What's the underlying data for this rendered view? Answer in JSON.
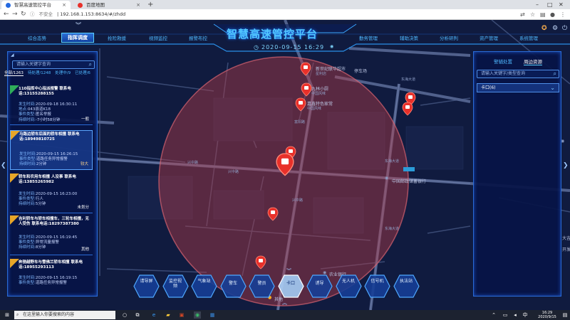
{
  "browser": {
    "tabs": [
      {
        "title": "智慧高速管控平台",
        "active": true
      },
      {
        "title": "百度地图",
        "active": false
      }
    ],
    "security_label": "不安全",
    "url": "192.168.1.153:8634/#/zhdd"
  },
  "header": {
    "nav_left": [
      "综合态势",
      "指挥调度",
      "抢险救援",
      "视频监控",
      "报警布控"
    ],
    "nav_right": [
      "勤务管理",
      "辅助决策",
      "分析研判",
      "资产管理",
      "系统管理"
    ],
    "active_nav": "指挥调度",
    "title": "智慧高速管控平台",
    "datetime": "2020-09-15 16:29"
  },
  "left_panel": {
    "search_placeholder": "请输入关键字查询",
    "filters": {
      "all": "全部/1263",
      "pending": "待处理/1248",
      "processing": "处理中/9",
      "done": "已处理/6"
    },
    "incidents": [
      {
        "ribbon": "已派",
        "title": "110指挥中心指派报警",
        "phone_label": "联系电话:",
        "phone": "13155288155",
        "rows": [
          {
            "label": "发生时间:",
            "value": "2020-09-18 16:30:11"
          },
          {
            "label": "地点:",
            "value": "043县道K18"
          },
          {
            "label": "事件类型:",
            "value": "匿名举报"
          },
          {
            "label": "持续时间:",
            "value": "-7小时58分钟"
          }
        ],
        "status": "一般"
      },
      {
        "ribbon": "急",
        "title": "马路边轿车后面的轿车相撞",
        "phone_label": "联系电话:",
        "phone": "18949810725",
        "rows": [
          {
            "label": "发生时间:",
            "value": "2020-09-15 16:26:15"
          },
          {
            "label": "事件类型:",
            "value": "道路任务异常报警"
          },
          {
            "label": "持续时间:",
            "value": "2分钟"
          }
        ],
        "status": "较大",
        "selected": true
      },
      {
        "ribbon": "急",
        "title": "轿车和农用车相撞 人没事",
        "phone_label": "联系电话:",
        "phone": "13855265982",
        "rows": [
          {
            "label": "发生时间:",
            "value": "2020-09-15 16:23:00"
          },
          {
            "label": "事件类型:",
            "value": "行人"
          },
          {
            "label": "持续时间:",
            "value": "5分钟"
          }
        ],
        "status": "未划分"
      },
      {
        "ribbon": "急",
        "title": "吉利轿车与轿车相撞车，三轮车相撞，无人受伤",
        "phone_label": "联系电话:",
        "phone": "18297387380",
        "rows": [
          {
            "label": "发生时间:",
            "value": "2020-09-15 16:19:45"
          },
          {
            "label": "事件类型:",
            "value": "异常流量报警"
          },
          {
            "label": "持续时间:",
            "value": "8分钟"
          }
        ],
        "status": "其他"
      },
      {
        "ribbon": "急",
        "title": "奔驰越野车与雪佛兰轿车相撞",
        "phone_label": "联系电话:",
        "phone": "18955293113",
        "rows": [
          {
            "label": "发生时间:",
            "value": "2020-09-15 16:19:15"
          },
          {
            "label": "事件类型:",
            "value": "道路任务异常报警"
          }
        ],
        "status": ""
      }
    ]
  },
  "right_panel": {
    "tabs": [
      "警辅处置",
      "周边资源"
    ],
    "active_tab": "周边资源",
    "search_placeholder": "请输入关键字/类型查询",
    "dropdown_value": "卡口(6)"
  },
  "map_labels": {
    "pois": [
      "新世纪联华超市",
      "九林小厨",
      "嘉鑫特色家常",
      "停车场",
      "中国邮政储蓄银行",
      "农业银行",
      "其他"
    ],
    "small": [
      "星利店",
      "中国风味",
      "中国风味"
    ],
    "roads": [
      "东海大道",
      "东海大道",
      "东海大道",
      "兴中路",
      "兴中路",
      "兴中路",
      "富阳路"
    ],
    "edge": [
      "大吉",
      "开发"
    ]
  },
  "toolbar": {
    "buttons": [
      "请导屏",
      "监控视频",
      "气象站",
      "警车",
      "警员",
      "卡口",
      "诱导",
      "无人机",
      "信号机",
      "执法站"
    ],
    "active": "卡口"
  },
  "taskbar": {
    "search_placeholder": "在这里输入你要搜索的内容",
    "time": "16:29",
    "date": "2020/9/15"
  },
  "colors": {
    "accent": "#2a6bd6",
    "glow": "#52c8ff",
    "alert_red": "#e8302a",
    "circle_fill": "#b43c46"
  }
}
